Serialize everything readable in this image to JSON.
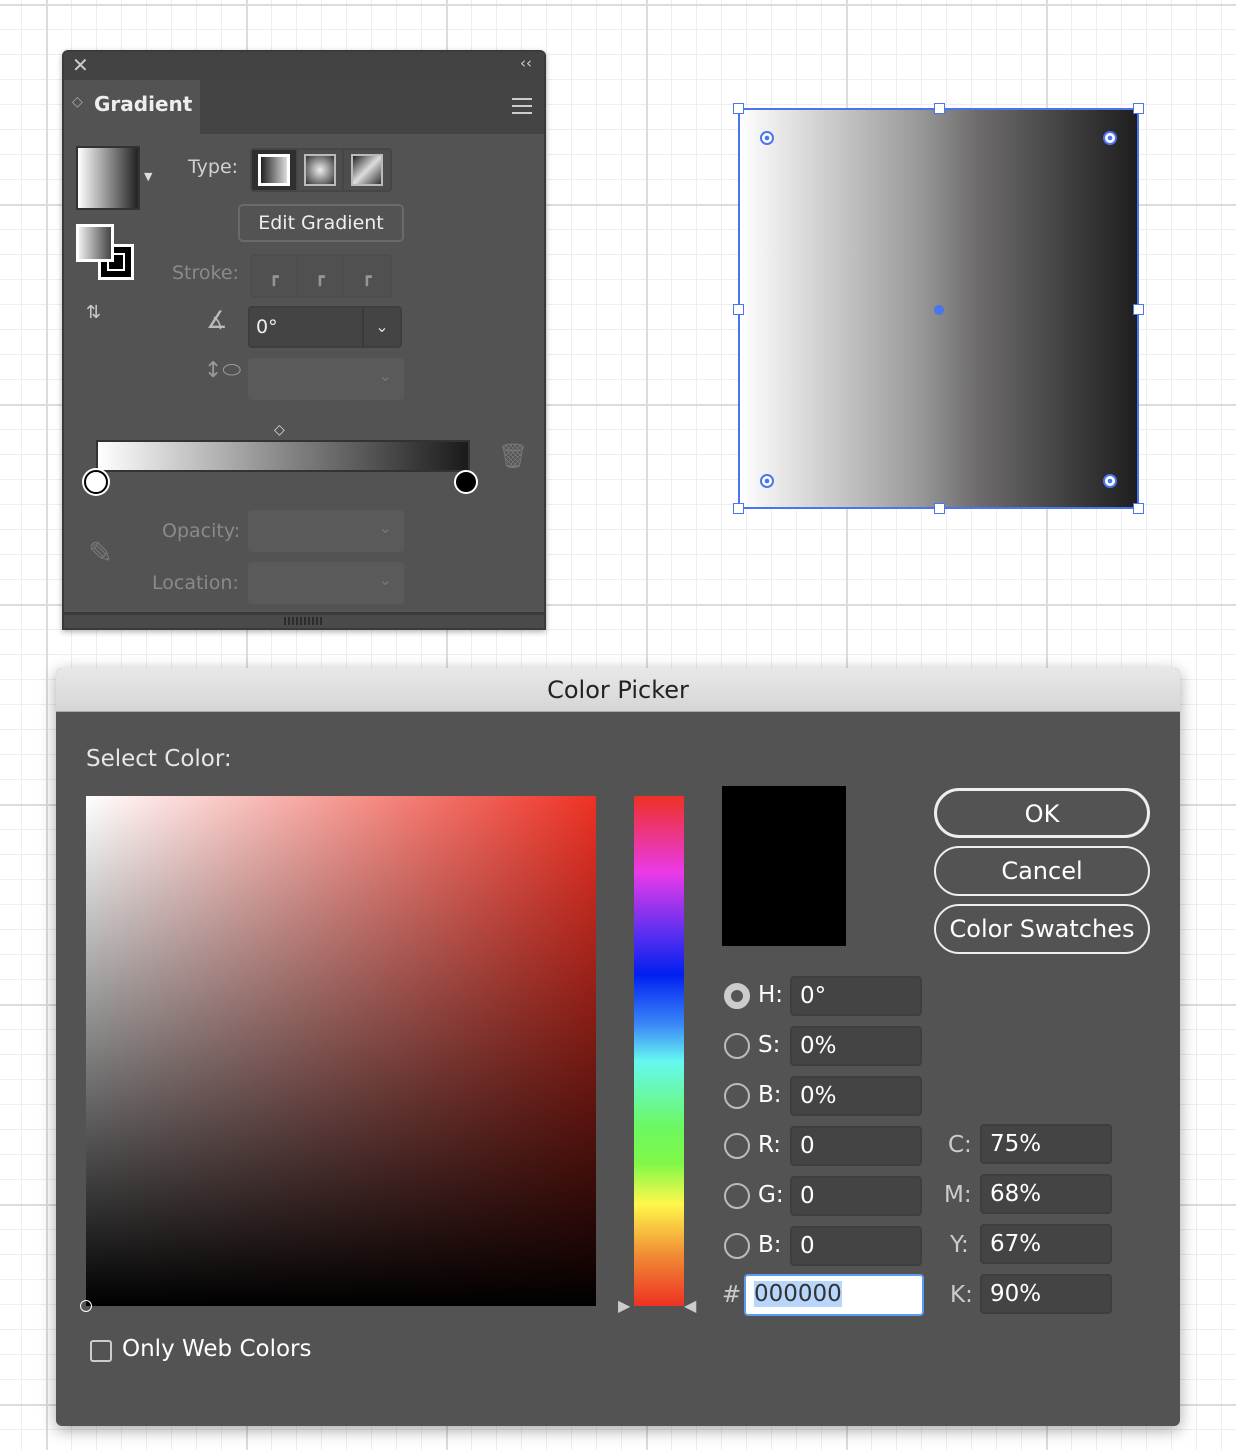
{
  "gradient_panel": {
    "title": "Gradient",
    "type_label": "Type:",
    "edit_gradient": "Edit Gradient",
    "stroke_label": "Stroke:",
    "angle_value": "0°",
    "opacity_label": "Opacity:",
    "location_label": "Location:",
    "stops": [
      {
        "color": "#ffffff",
        "location": 0
      },
      {
        "color": "#000000",
        "location": 100
      }
    ],
    "gradient_type": "linear"
  },
  "color_picker": {
    "title": "Color Picker",
    "select_color": "Select Color:",
    "ok": "OK",
    "cancel": "Cancel",
    "swatches": "Color Swatches",
    "selected_mode": "H",
    "hsb": [
      {
        "label": "H:",
        "value": "0°"
      },
      {
        "label": "S:",
        "value": "0%"
      },
      {
        "label": "B:",
        "value": "0%"
      }
    ],
    "rgb": [
      {
        "label": "R:",
        "value": "0"
      },
      {
        "label": "G:",
        "value": "0"
      },
      {
        "label": "B:",
        "value": "0"
      }
    ],
    "cmyk": [
      {
        "label": "C:",
        "value": "75%"
      },
      {
        "label": "M:",
        "value": "68%"
      },
      {
        "label": "Y:",
        "value": "67%"
      },
      {
        "label": "K:",
        "value": "90%"
      }
    ],
    "hash": "#",
    "hex": "000000",
    "only_web": "Only Web Colors",
    "current_color": "#000000",
    "hue_color": "#ee3124"
  }
}
